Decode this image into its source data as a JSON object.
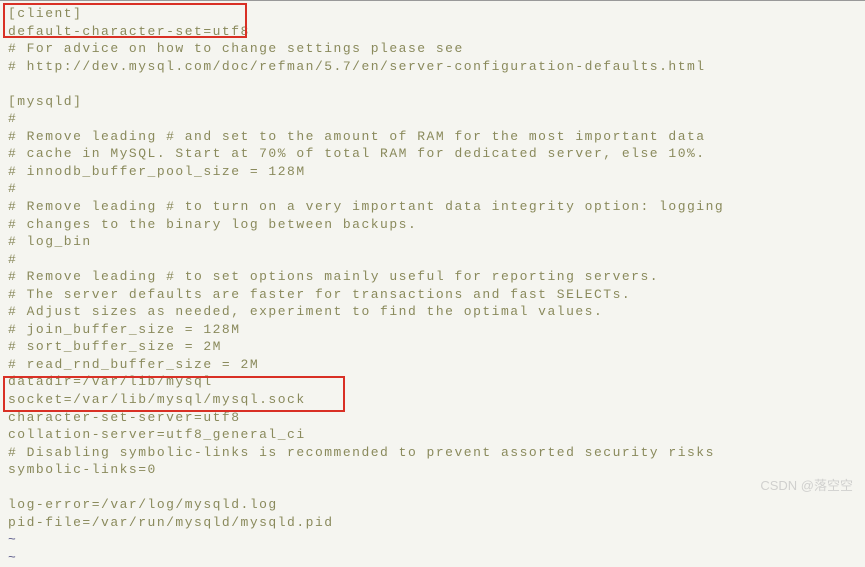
{
  "config": {
    "lines": [
      "[client]",
      "default-character-set=utf8",
      "# For advice on how to change settings please see",
      "# http://dev.mysql.com/doc/refman/5.7/en/server-configuration-defaults.html",
      "",
      "[mysqld]",
      "#",
      "# Remove leading # and set to the amount of RAM for the most important data",
      "# cache in MySQL. Start at 70% of total RAM for dedicated server, else 10%.",
      "# innodb_buffer_pool_size = 128M",
      "#",
      "# Remove leading # to turn on a very important data integrity option: logging",
      "# changes to the binary log between backups.",
      "# log_bin",
      "#",
      "# Remove leading # to set options mainly useful for reporting servers.",
      "# The server defaults are faster for transactions and fast SELECTs.",
      "# Adjust sizes as needed, experiment to find the optimal values.",
      "# join_buffer_size = 128M",
      "# sort_buffer_size = 2M",
      "# read_rnd_buffer_size = 2M",
      "datadir=/var/lib/mysql",
      "socket=/var/lib/mysql/mysql.sock",
      "character-set-server=utf8",
      "collation-server=utf8_general_ci",
      "# Disabling symbolic-links is recommended to prevent assorted security risks",
      "symbolic-links=0",
      "",
      "log-error=/var/log/mysqld.log",
      "pid-file=/var/run/mysqld/mysqld.pid"
    ],
    "tildes": [
      "~",
      "~"
    ]
  },
  "watermark": "CSDN @落空空"
}
